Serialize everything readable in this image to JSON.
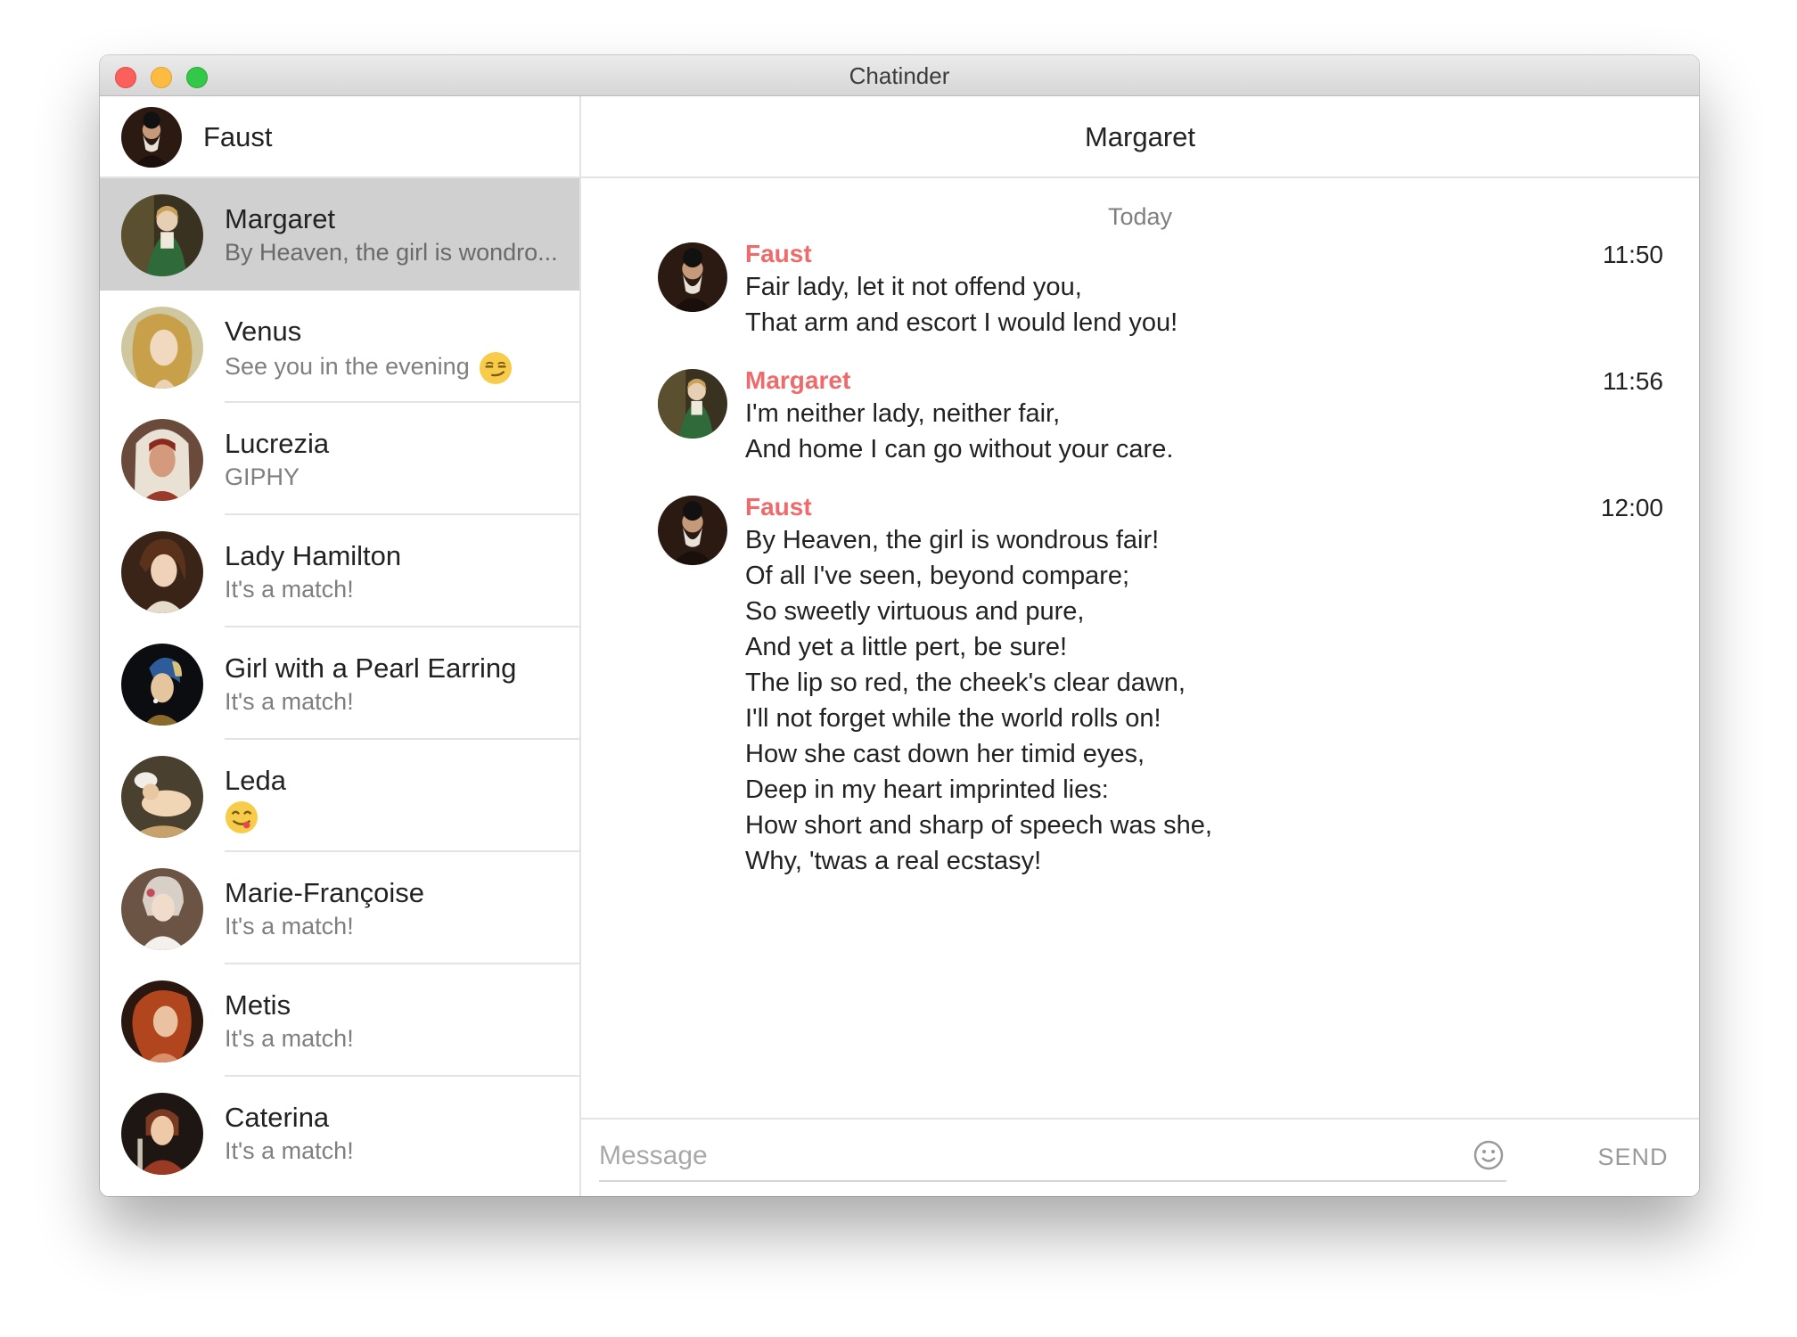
{
  "window": {
    "title": "Chatinder"
  },
  "me": {
    "name": "Faust",
    "avatar": "faust-portrait"
  },
  "conversations": [
    {
      "name": "Margaret",
      "preview": "By Heaven, the girl is wondro...",
      "avatar": "margaret-portrait",
      "selected": true
    },
    {
      "name": "Venus",
      "preview": "See you in the evening",
      "emoji": "smirking-face",
      "avatar": "venus-portrait"
    },
    {
      "name": "Lucrezia",
      "preview": "GIPHY",
      "avatar": "lucrezia-portrait"
    },
    {
      "name": "Lady Hamilton",
      "preview": "It's a match!",
      "avatar": "lady-hamilton-portrait"
    },
    {
      "name": "Girl with a Pearl Earring",
      "preview": "It's a match!",
      "avatar": "pearl-earring-portrait"
    },
    {
      "name": "Leda",
      "preview": "",
      "emoji": "face-savoring-food",
      "avatar": "leda-portrait"
    },
    {
      "name": "Marie-Françoise",
      "preview": "It's a match!",
      "avatar": "marie-francoise-portrait"
    },
    {
      "name": "Metis",
      "preview": "It's a match!",
      "avatar": "metis-portrait"
    },
    {
      "name": "Caterina",
      "preview": "It's a match!",
      "avatar": "caterina-portrait"
    }
  ],
  "chat": {
    "title": "Margaret",
    "day_separator": "Today",
    "messages": [
      {
        "sender": "Faust",
        "time": "11:50",
        "lines": [
          "Fair lady, let it not offend you,",
          "That arm and escort I would lend you!"
        ]
      },
      {
        "sender": "Margaret",
        "time": "11:56",
        "lines": [
          "I'm neither lady, neither fair,",
          "And home I can go without your care."
        ]
      },
      {
        "sender": "Faust",
        "time": "12:00",
        "lines": [
          "By Heaven, the girl is wondrous fair!",
          "Of all I've seen, beyond compare;",
          "So sweetly virtuous and pure,",
          "And yet a little pert, be sure!",
          "The lip so red, the cheek's clear dawn,",
          "I'll not forget while the world rolls on!",
          "How she cast down her timid eyes,",
          "Deep in my heart imprinted lies:",
          "How short and sharp of speech was she,",
          "Why, 'twas a real ecstasy!"
        ]
      }
    ]
  },
  "composer": {
    "placeholder": "Message",
    "value": "",
    "send_label": "SEND",
    "emoji_icon": "smiley-icon"
  },
  "colors": {
    "sender": "#ef6a6a",
    "selected_row": "#d0d0d0",
    "divider": "#e3e3e3"
  }
}
